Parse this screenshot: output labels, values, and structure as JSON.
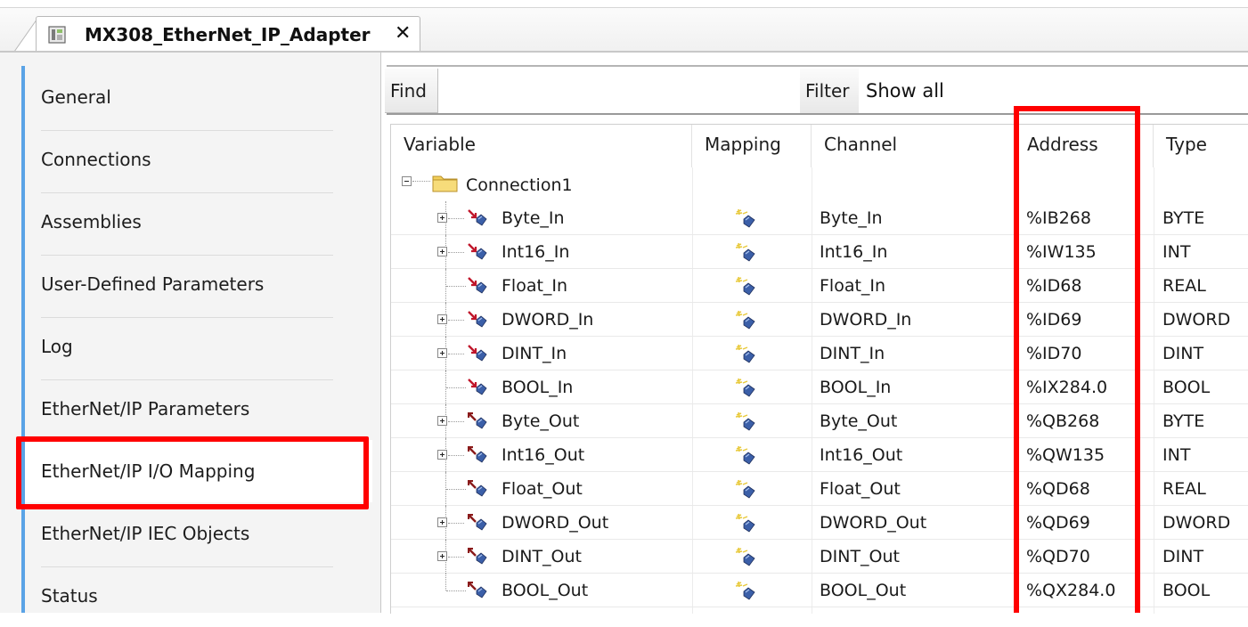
{
  "document_tab": {
    "title": "MX308_EtherNet_IP_Adapter",
    "close_label": "✕",
    "icon": "device-icon"
  },
  "nav": {
    "items": [
      {
        "label": "General"
      },
      {
        "label": "Connections"
      },
      {
        "label": "Assemblies"
      },
      {
        "label": "User-Defined Parameters"
      },
      {
        "label": "Log"
      },
      {
        "label": "EtherNet/IP Parameters"
      },
      {
        "label": "EtherNet/IP I/O Mapping"
      },
      {
        "label": "EtherNet/IP IEC Objects"
      },
      {
        "label": "Status"
      }
    ],
    "selected_index": 6
  },
  "toolbar": {
    "find_label": "Find",
    "filter_label": "Filter",
    "filter_value": "Show all"
  },
  "grid": {
    "headers": {
      "variable": "Variable",
      "mapping": "Mapping",
      "channel": "Channel",
      "address": "Address",
      "type": "Type"
    },
    "folder": {
      "label": "Connection1",
      "expanded": true
    },
    "rows": [
      {
        "variable": "Byte_In",
        "channel": "Byte_In",
        "address": "%IB268",
        "type": "BYTE",
        "dir": "in",
        "expandable": true
      },
      {
        "variable": "Int16_In",
        "channel": "Int16_In",
        "address": "%IW135",
        "type": "INT",
        "dir": "in",
        "expandable": true
      },
      {
        "variable": "Float_In",
        "channel": "Float_In",
        "address": "%ID68",
        "type": "REAL",
        "dir": "in",
        "expandable": false
      },
      {
        "variable": "DWORD_In",
        "channel": "DWORD_In",
        "address": "%ID69",
        "type": "DWORD",
        "dir": "in",
        "expandable": true
      },
      {
        "variable": "DINT_In",
        "channel": "DINT_In",
        "address": "%ID70",
        "type": "DINT",
        "dir": "in",
        "expandable": true
      },
      {
        "variable": "BOOL_In",
        "channel": "BOOL_In",
        "address": "%IX284.0",
        "type": "BOOL",
        "dir": "in",
        "expandable": false
      },
      {
        "variable": "Byte_Out",
        "channel": "Byte_Out",
        "address": "%QB268",
        "type": "BYTE",
        "dir": "out",
        "expandable": true
      },
      {
        "variable": "Int16_Out",
        "channel": "Int16_Out",
        "address": "%QW135",
        "type": "INT",
        "dir": "out",
        "expandable": true
      },
      {
        "variable": "Float_Out",
        "channel": "Float_Out",
        "address": "%QD68",
        "type": "REAL",
        "dir": "out",
        "expandable": false
      },
      {
        "variable": "DWORD_Out",
        "channel": "DWORD_Out",
        "address": "%QD69",
        "type": "DWORD",
        "dir": "out",
        "expandable": true
      },
      {
        "variable": "DINT_Out",
        "channel": "DINT_Out",
        "address": "%QD70",
        "type": "DINT",
        "dir": "out",
        "expandable": true
      },
      {
        "variable": "BOOL_Out",
        "channel": "BOOL_Out",
        "address": "%QX284.0",
        "type": "BOOL",
        "dir": "out",
        "expandable": false
      }
    ]
  },
  "colors": {
    "highlight": "#ff0000",
    "nav_accent": "#5aa3e6",
    "in_arrow": "#c0162b",
    "out_arrow": "#8a1a1a",
    "variable_icon": "#3b5fa8"
  }
}
